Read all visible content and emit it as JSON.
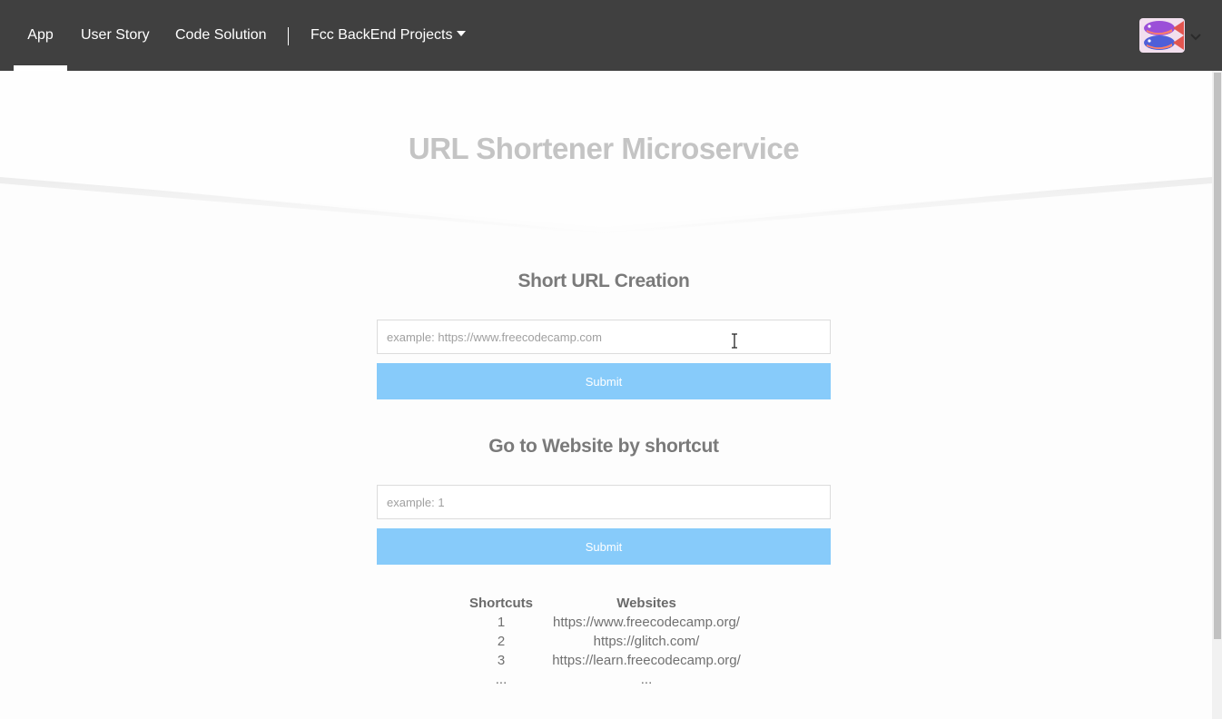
{
  "nav": {
    "items": [
      {
        "label": "App",
        "active": true
      },
      {
        "label": "User Story"
      },
      {
        "label": "Code Solution"
      },
      {
        "label": "Fcc BackEnd Projects",
        "dropdown": true
      }
    ],
    "avatar_icon": "fish-avatar-icon",
    "background": "#404040"
  },
  "hero": {
    "title": "URL Shortener Microservice"
  },
  "create": {
    "title": "Short URL Creation",
    "placeholder": "example: https://www.freecodecamp.com",
    "submit_label": "Submit"
  },
  "goto": {
    "title": "Go to Website by shortcut",
    "placeholder": "example: 1",
    "submit_label": "Submit"
  },
  "shortcuts": {
    "headers": [
      "Shortcuts",
      "Websites"
    ],
    "rows": [
      [
        "1",
        "https://www.freecodecamp.org/"
      ],
      [
        "2",
        "https://glitch.com/"
      ],
      [
        "3",
        "https://learn.freecodecamp.org/"
      ],
      [
        "...",
        "..."
      ]
    ]
  },
  "colors": {
    "accent_button": "#87cbfa",
    "title_grey": "#c4c4c4"
  }
}
